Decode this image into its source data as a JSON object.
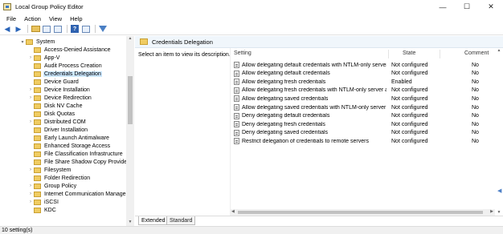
{
  "window": {
    "title": "Local Group Policy Editor",
    "minimize": "—",
    "maximize": "☐",
    "close": "✕"
  },
  "menu": [
    "File",
    "Action",
    "View",
    "Help"
  ],
  "tree": {
    "parent": "System",
    "items": [
      {
        "label": "Access-Denied Assistance",
        "expandable": false
      },
      {
        "label": "App-V",
        "expandable": true
      },
      {
        "label": "Audit Process Creation",
        "expandable": false
      },
      {
        "label": "Credentials Delegation",
        "expandable": false,
        "selected": true
      },
      {
        "label": "Device Guard",
        "expandable": false
      },
      {
        "label": "Device Installation",
        "expandable": true
      },
      {
        "label": "Device Redirection",
        "expandable": true
      },
      {
        "label": "Disk NV Cache",
        "expandable": false
      },
      {
        "label": "Disk Quotas",
        "expandable": false
      },
      {
        "label": "Distributed COM",
        "expandable": true
      },
      {
        "label": "Driver Installation",
        "expandable": false
      },
      {
        "label": "Early Launch Antimalware",
        "expandable": false
      },
      {
        "label": "Enhanced Storage Access",
        "expandable": false
      },
      {
        "label": "File Classification Infrastructure",
        "expandable": false
      },
      {
        "label": "File Share Shadow Copy Provider",
        "expandable": false
      },
      {
        "label": "Filesystem",
        "expandable": true
      },
      {
        "label": "Folder Redirection",
        "expandable": false
      },
      {
        "label": "Group Policy",
        "expandable": true
      },
      {
        "label": "Internet Communication Manager",
        "expandable": true
      },
      {
        "label": "iSCSI",
        "expandable": true
      },
      {
        "label": "KDC",
        "expandable": false
      }
    ]
  },
  "pane": {
    "title": "Credentials Delegation",
    "description": "Select an item to view its description.",
    "columns": {
      "setting": "Setting",
      "state": "State",
      "comment": "Comment"
    },
    "rows": [
      {
        "setting": "Allow delegating default credentials with NTLM-only server ...",
        "state": "Not configured",
        "comment": "No"
      },
      {
        "setting": "Allow delegating default credentials",
        "state": "Not configured",
        "comment": "No"
      },
      {
        "setting": "Allow delegating fresh credentials",
        "state": "Enabled",
        "comment": "No"
      },
      {
        "setting": "Allow delegating fresh credentials with NTLM-only server a...",
        "state": "Not configured",
        "comment": "No"
      },
      {
        "setting": "Allow delegating saved credentials",
        "state": "Not configured",
        "comment": "No"
      },
      {
        "setting": "Allow delegating saved credentials with NTLM-only server a...",
        "state": "Not configured",
        "comment": "No"
      },
      {
        "setting": "Deny delegating default credentials",
        "state": "Not configured",
        "comment": "No"
      },
      {
        "setting": "Deny delegating fresh credentials",
        "state": "Not configured",
        "comment": "No"
      },
      {
        "setting": "Deny delegating saved credentials",
        "state": "Not configured",
        "comment": "No"
      },
      {
        "setting": "Restrict delegation of credentials to remote servers",
        "state": "Not configured",
        "comment": "No"
      }
    ],
    "tabs": [
      "Extended",
      "Standard"
    ]
  },
  "status": "10 setting(s)"
}
